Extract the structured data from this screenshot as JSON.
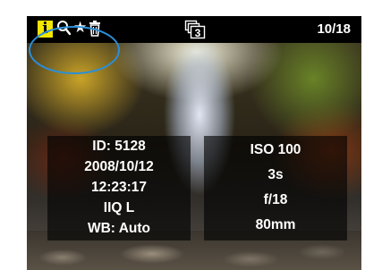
{
  "topbar": {
    "icons": [
      "info-icon",
      "zoom-icon",
      "star-icon",
      "trash-icon",
      "image-stack-icon"
    ],
    "info_glyph": "i",
    "stack_count": "3",
    "counter": "10/18",
    "colors": {
      "info_bg": "#f3e600",
      "highlight": "#2a8fd8"
    }
  },
  "info_left": {
    "id": "ID: 5128",
    "date": "2008/10/12",
    "time": "12:23:17",
    "quality": "IIQ L",
    "wb": "WB: Auto"
  },
  "info_right": {
    "iso": "ISO 100",
    "shutter": "3s",
    "aperture": "f/18",
    "focal_length": "80mm"
  }
}
